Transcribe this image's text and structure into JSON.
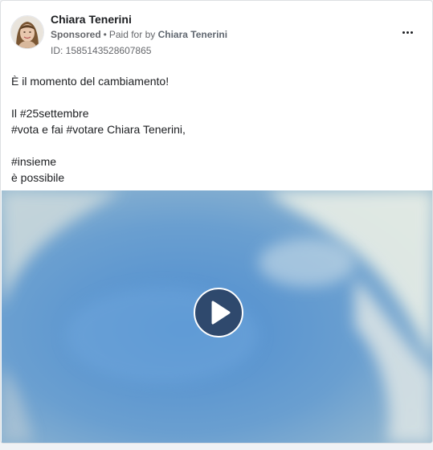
{
  "post": {
    "page_name": "Chiara Tenerini",
    "sponsored_label": "Sponsored",
    "separator": "•",
    "paid_for_by_label": "Paid for by",
    "payer_name": "Chiara Tenerini",
    "ad_id": "ID: 1585143528607865",
    "body": {
      "line1": "È il momento del cambiamento!",
      "line2": "Il #25settembre",
      "line3": "#vota e fai #votare Chiara Tenerini,",
      "line4": "#insieme",
      "line5": "è possibile"
    }
  },
  "icons": {
    "avatar": "profile-photo",
    "more": "more-options-icon",
    "play": "play-icon"
  },
  "colors": {
    "sky": "#6a9ccb",
    "secondary_text": "#65676b",
    "play_bg": "#283e5f"
  }
}
